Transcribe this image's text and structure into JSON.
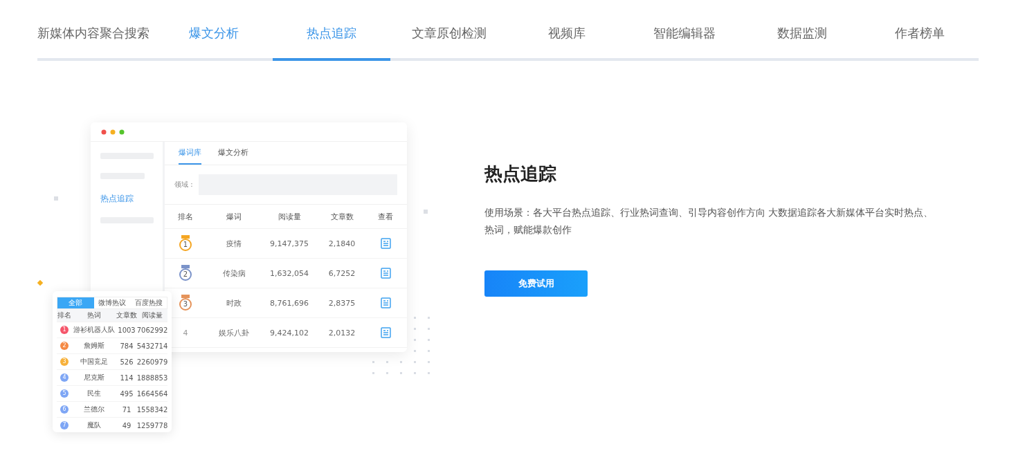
{
  "nav_tabs": [
    {
      "label": "新媒体内容聚合搜索",
      "selected": false,
      "highlighted": false
    },
    {
      "label": "爆文分析",
      "selected": false,
      "highlighted": true
    },
    {
      "label": "热点追踪",
      "selected": true,
      "highlighted": false
    },
    {
      "label": "文章原创检测",
      "selected": false,
      "highlighted": false
    },
    {
      "label": "视频库",
      "selected": false,
      "highlighted": false
    },
    {
      "label": "智能编辑器",
      "selected": false,
      "highlighted": false
    },
    {
      "label": "数据监测",
      "selected": false,
      "highlighted": false
    },
    {
      "label": "作者榜单",
      "selected": false,
      "highlighted": false
    }
  ],
  "app_window": {
    "sidebar": [
      {
        "kind": "bar"
      },
      {
        "kind": "bar"
      },
      {
        "kind": "link",
        "label": "热点追踪"
      },
      {
        "kind": "bar"
      }
    ],
    "tabs": [
      {
        "label": "爆词库",
        "selected": true
      },
      {
        "label": "爆文分析",
        "selected": false
      }
    ],
    "field": {
      "label": "领域 :"
    },
    "table": {
      "columns": [
        "排名",
        "爆词",
        "阅读量",
        "文章数",
        "查看"
      ],
      "rows": [
        {
          "kind": "medal",
          "rank": "1",
          "color": "#f5a623",
          "word": "疫情",
          "reads": "9,147,375",
          "articles": "2,1840"
        },
        {
          "kind": "medal",
          "rank": "2",
          "color": "#7b93c9",
          "word": "传染病",
          "reads": "1,632,054",
          "articles": "6,7252"
        },
        {
          "kind": "medal",
          "rank": "3",
          "color": "#e5935a",
          "word": "时政",
          "reads": "8,761,696",
          "articles": "2,8375"
        },
        {
          "kind": "plain",
          "rank": "4",
          "word": "娱乐八卦",
          "reads": "9,424,102",
          "articles": "2,0132"
        }
      ]
    }
  },
  "mini_card": {
    "tabs": [
      {
        "label": "全部",
        "selected": true
      },
      {
        "label": "微博热议",
        "selected": false
      },
      {
        "label": "百度热搜",
        "selected": false
      }
    ],
    "columns": [
      "排名",
      "热词",
      "文章数",
      "阅读量"
    ],
    "rows": [
      {
        "rank": "1",
        "color": "#f5566b",
        "word": "游衫机器人队",
        "articles": "1003",
        "reads": "7062992"
      },
      {
        "rank": "2",
        "color": "#f58a45",
        "word": "詹姆斯",
        "articles": "784",
        "reads": "5432714"
      },
      {
        "rank": "3",
        "color": "#f7b13b",
        "word": "中国竞足",
        "articles": "526",
        "reads": "2260979"
      },
      {
        "rank": "4",
        "color": "#7ea6f5",
        "word": "尼克斯",
        "articles": "114",
        "reads": "1888853"
      },
      {
        "rank": "5",
        "color": "#7ea6f5",
        "word": "民生",
        "articles": "495",
        "reads": "1664564"
      },
      {
        "rank": "6",
        "color": "#7ea6f5",
        "word": "兰德尔",
        "articles": "71",
        "reads": "1558342"
      },
      {
        "rank": "7",
        "color": "#7ea6f5",
        "word": "魔队",
        "articles": "49",
        "reads": "1259778"
      }
    ]
  },
  "feature": {
    "title": "热点追踪",
    "description": "使用场景：各大平台热点追踪、行业热词查询、引导内容创作方向 大数据追踪各大新媒体平台实时热点、热词，赋能爆款创作",
    "button": "免费试用"
  }
}
